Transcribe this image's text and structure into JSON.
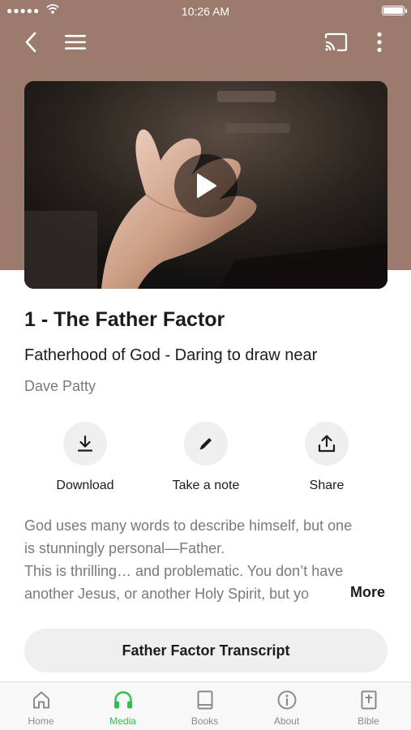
{
  "status_bar": {
    "time": "10:26 AM"
  },
  "top_nav": {
    "back_icon": "chevron-left-icon",
    "menu_icon": "hamburger-icon",
    "cast_icon": "cast-icon",
    "more_icon": "more-vertical-icon"
  },
  "video": {
    "play_icon": "play-icon"
  },
  "episode": {
    "title": "1 - The Father Factor",
    "subtitle": "Fatherhood of God - Daring to draw near",
    "author": "Dave Patty"
  },
  "actions": [
    {
      "label": "Download",
      "icon": "download-icon"
    },
    {
      "label": "Take a note",
      "icon": "pencil-icon"
    },
    {
      "label": "Share",
      "icon": "share-icon"
    }
  ],
  "description": {
    "lines": [
      "God uses many words to describe himself, but one",
      "is stunningly personal—Father.",
      "This is thrilling… and problematic. You don’t have",
      "another Jesus, or another Holy Spirit, but yo"
    ],
    "more_label": "More"
  },
  "transcript_button": {
    "label": "Father Factor Transcript"
  },
  "tabs": [
    {
      "label": "Home",
      "icon": "home-icon",
      "active": false
    },
    {
      "label": "Media",
      "icon": "headphones-icon",
      "active": true
    },
    {
      "label": "Books",
      "icon": "book-icon",
      "active": false
    },
    {
      "label": "About",
      "icon": "info-icon",
      "active": false
    },
    {
      "label": "Bible",
      "icon": "bible-icon",
      "active": false
    }
  ],
  "colors": {
    "header_bg": "#9b7b6e",
    "accent": "#2fbf4f",
    "button_bg": "#efefef",
    "text_muted": "#7a7a7a"
  }
}
